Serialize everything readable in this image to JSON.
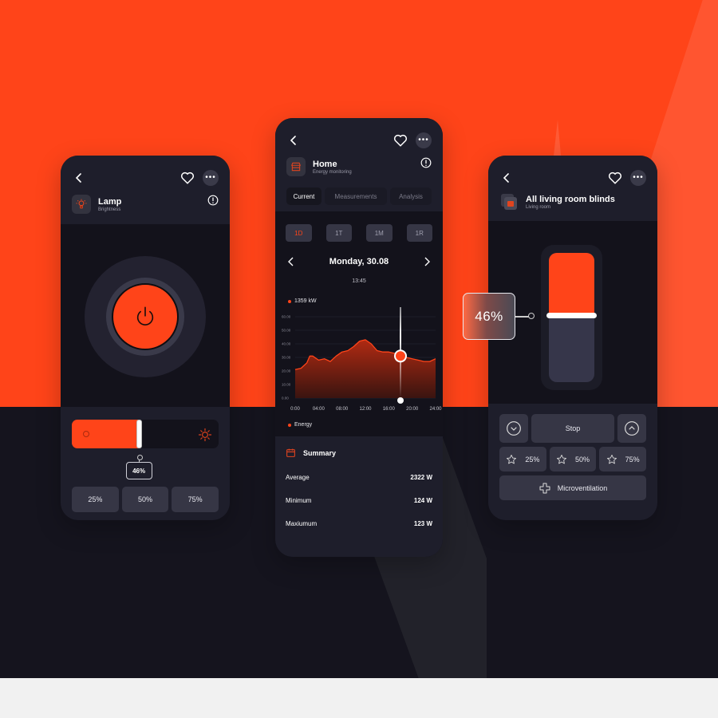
{
  "colors": {
    "accent": "#ff4419",
    "dark": "#13121b",
    "panel": "#1e1e2b",
    "button": "#363645"
  },
  "lamp": {
    "title": "Lamp",
    "subtitle": "Brightness",
    "icons": [
      "back-icon",
      "heart-icon",
      "more-icon",
      "lamp-icon",
      "info-icon",
      "power-icon",
      "sun-icon"
    ],
    "brightness_percent": 46,
    "brightness_label": "46%",
    "presets": [
      "25%",
      "50%",
      "75%"
    ]
  },
  "energy": {
    "title": "Home",
    "subtitle": "Energy monitoring",
    "tabs": [
      {
        "label": "Current",
        "active": true
      },
      {
        "label": "Measurements",
        "active": false
      },
      {
        "label": "Analysis",
        "active": false
      }
    ],
    "ranges": [
      {
        "label": "1D",
        "active": true
      },
      {
        "label": "1T",
        "active": false
      },
      {
        "label": "1M",
        "active": false
      },
      {
        "label": "1R",
        "active": false
      }
    ],
    "date": "Monday, 30.08",
    "time": "13:45",
    "value_label": "1359 kW",
    "legend": "Energy",
    "summary": {
      "title": "Summary",
      "rows": [
        {
          "label": "Average",
          "value": "2322 W"
        },
        {
          "label": "Minimum",
          "value": "124 W"
        },
        {
          "label": "Maxiumum",
          "value": "123 W"
        }
      ]
    }
  },
  "chart_data": {
    "type": "area",
    "title": "",
    "xlabel": "",
    "ylabel": "",
    "x_ticks": [
      "0:00",
      "04:00",
      "08:00",
      "12:00",
      "16:00",
      "20:00",
      "24:00"
    ],
    "y_ticks": [
      "0.00",
      "10.00",
      "20.00",
      "30.00",
      "40.00",
      "50.00",
      "60.00"
    ],
    "ylim": [
      0,
      60
    ],
    "xlim": [
      0,
      24
    ],
    "grid": true,
    "series": [
      {
        "name": "Energy",
        "x": [
          0,
          1,
          2,
          2.5,
          3,
          4,
          5,
          6,
          7,
          8,
          9,
          10,
          11,
          12,
          13,
          14,
          15,
          16,
          17,
          18,
          19,
          20,
          21,
          22,
          23,
          24
        ],
        "values": [
          21,
          22,
          26,
          31,
          31,
          28,
          29,
          27,
          31,
          34,
          35,
          38,
          42,
          43,
          40,
          35,
          34,
          34,
          33,
          31,
          30,
          29,
          28,
          27,
          27,
          29
        ]
      }
    ],
    "cursor_x": 18,
    "cursor_value": 31
  },
  "blinds": {
    "title": "All living room blinds",
    "subtitle": "Living room",
    "position_percent": 46,
    "position_label": "46%",
    "stop_label": "Stop",
    "presets": [
      "25%",
      "50%",
      "75%"
    ],
    "microventilation_label": "Microventilation"
  }
}
